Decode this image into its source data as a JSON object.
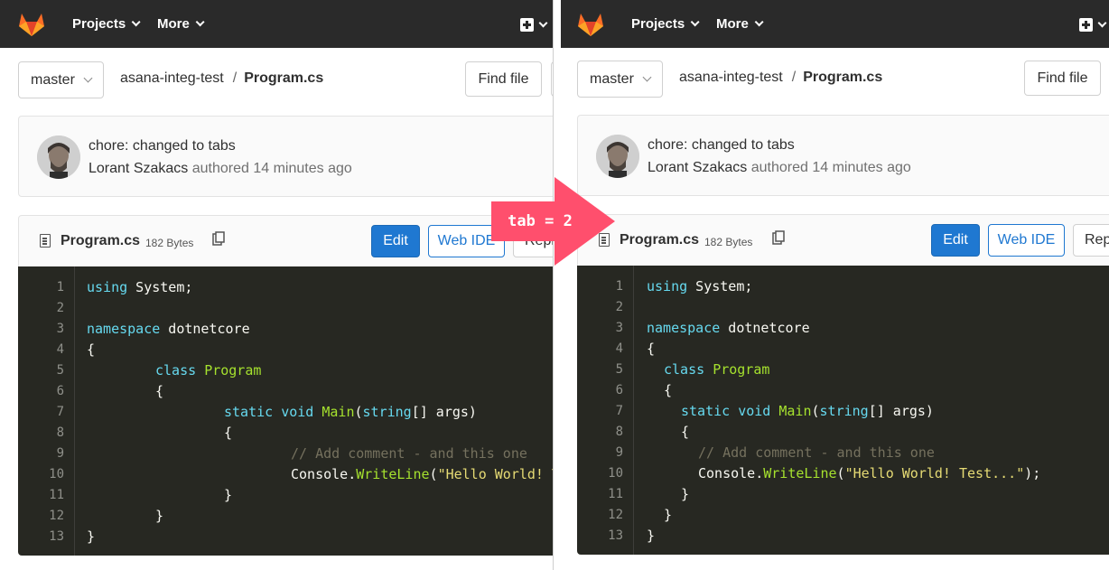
{
  "nav": {
    "projects": "Projects",
    "more": "More"
  },
  "repo": {
    "branch": "master",
    "project": "asana-integ-test",
    "separator": "/",
    "file": "Program.cs",
    "find_file": "Find file"
  },
  "commit": {
    "title": "chore: changed to tabs",
    "author": "Lorant Szakacs",
    "authored": "authored",
    "time": "14 minutes ago"
  },
  "file": {
    "name": "Program.cs",
    "size": "182 Bytes",
    "edit": "Edit",
    "web_ide": "Web IDE",
    "replace": "Replace"
  },
  "overlay": {
    "label": "tab = 2",
    "color": "#ff4f6d"
  },
  "line_numbers": [
    "1",
    "2",
    "3",
    "4",
    "5",
    "6",
    "7",
    "8",
    "9",
    "10",
    "11",
    "12",
    "13"
  ],
  "code_left": {
    "l1_kw": "using",
    "l1_rest": " System;",
    "l3_kw": "namespace",
    "l3_rest": " dotnetcore",
    "l4": "{",
    "l5_kw": "class",
    "l5_ty": "Program",
    "l6": "{",
    "l7_kw": "static void",
    "l7_fn": "Main",
    "l7_p1": "(",
    "l7_kw2": "string",
    "l7_p2": "[] args)",
    "l8": "{",
    "l9": "// Add comment - and this one",
    "l10_a": "Console.",
    "l10_fn": "WriteLine",
    "l10_b": "(",
    "l10_str": "\"Hello World! Test...\"",
    "l10_c": ");",
    "l11": "}",
    "l12": "}",
    "l13": "}"
  },
  "code_right": {
    "l1_kw": "using",
    "l1_rest": " System;",
    "l3_kw": "namespace",
    "l3_rest": " dotnetcore",
    "l4": "{",
    "l5_kw": "class",
    "l5_ty": "Program",
    "l6": "{",
    "l7_kw": "static void",
    "l7_fn": "Main",
    "l7_p1": "(",
    "l7_kw2": "string",
    "l7_p2": "[] args)",
    "l8": "{",
    "l9": "// Add comment - and this one",
    "l10_a": "Console.",
    "l10_fn": "WriteLine",
    "l10_b": "(",
    "l10_str": "\"Hello World! Test...\"",
    "l10_c": ");",
    "l11": "}",
    "l12": "}",
    "l13": "}"
  },
  "icons": {
    "logo": "gitlab-tanuki-icon",
    "new": "plus-square-icon",
    "file": "file-text-icon",
    "copy": "clipboard-icon",
    "dropdown": "chevron-down-icon"
  }
}
